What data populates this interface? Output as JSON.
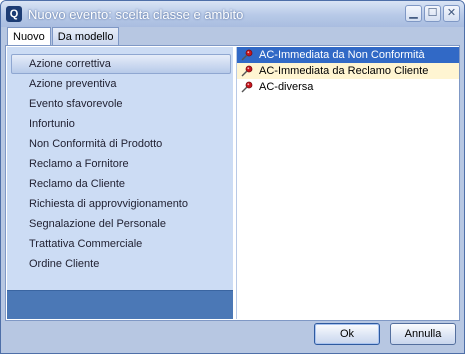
{
  "window": {
    "title": "Nuovo evento: scelta classe e ambito",
    "app_icon": "Q"
  },
  "titlebar_buttons": [
    {
      "name": "minimize",
      "glyph": "▁"
    },
    {
      "name": "maximize",
      "glyph": "☐"
    },
    {
      "name": "close",
      "glyph": "✕"
    }
  ],
  "tabs": [
    {
      "label": "Nuovo",
      "active": true
    },
    {
      "label": "Da modello",
      "active": false
    }
  ],
  "left_list": {
    "items": [
      "Azione correttiva",
      "Azione preventiva",
      "Evento sfavorevole",
      "Infortunio",
      "Non Conformità di Prodotto",
      "Reclamo a Fornitore",
      "Reclamo da Cliente",
      "Richiesta di approvvigionamento",
      "Segnalazione del Personale",
      "Trattativa Commerciale",
      "Ordine Cliente"
    ],
    "selected_index": 0
  },
  "right_list": {
    "items": [
      "AC-Immediata da Non Conformità",
      "AC-Immediata da Reclamo Cliente",
      "AC-diversa"
    ],
    "selected_index": 0,
    "hover_index": 1,
    "item_icon": "pushpin-icon"
  },
  "buttons": {
    "ok": "Ok",
    "cancel": "Annulla"
  },
  "colors": {
    "title_text": "#ffffff",
    "selection": "#3169c6",
    "hover": "#fff5d2",
    "left_pane": "#ccdcf4",
    "left_footer": "#4b78b6"
  }
}
